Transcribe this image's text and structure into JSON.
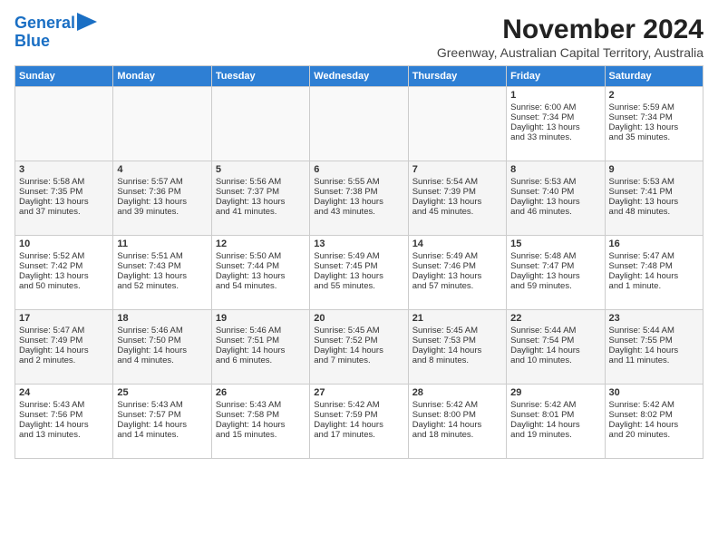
{
  "logo": {
    "line1": "General",
    "line2": "Blue"
  },
  "title": "November 2024",
  "subtitle": "Greenway, Australian Capital Territory, Australia",
  "headers": [
    "Sunday",
    "Monday",
    "Tuesday",
    "Wednesday",
    "Thursday",
    "Friday",
    "Saturday"
  ],
  "weeks": [
    [
      {
        "day": "",
        "content": ""
      },
      {
        "day": "",
        "content": ""
      },
      {
        "day": "",
        "content": ""
      },
      {
        "day": "",
        "content": ""
      },
      {
        "day": "",
        "content": ""
      },
      {
        "day": "1",
        "content": "Sunrise: 6:00 AM\nSunset: 7:34 PM\nDaylight: 13 hours\nand 33 minutes."
      },
      {
        "day": "2",
        "content": "Sunrise: 5:59 AM\nSunset: 7:34 PM\nDaylight: 13 hours\nand 35 minutes."
      }
    ],
    [
      {
        "day": "3",
        "content": "Sunrise: 5:58 AM\nSunset: 7:35 PM\nDaylight: 13 hours\nand 37 minutes."
      },
      {
        "day": "4",
        "content": "Sunrise: 5:57 AM\nSunset: 7:36 PM\nDaylight: 13 hours\nand 39 minutes."
      },
      {
        "day": "5",
        "content": "Sunrise: 5:56 AM\nSunset: 7:37 PM\nDaylight: 13 hours\nand 41 minutes."
      },
      {
        "day": "6",
        "content": "Sunrise: 5:55 AM\nSunset: 7:38 PM\nDaylight: 13 hours\nand 43 minutes."
      },
      {
        "day": "7",
        "content": "Sunrise: 5:54 AM\nSunset: 7:39 PM\nDaylight: 13 hours\nand 45 minutes."
      },
      {
        "day": "8",
        "content": "Sunrise: 5:53 AM\nSunset: 7:40 PM\nDaylight: 13 hours\nand 46 minutes."
      },
      {
        "day": "9",
        "content": "Sunrise: 5:53 AM\nSunset: 7:41 PM\nDaylight: 13 hours\nand 48 minutes."
      }
    ],
    [
      {
        "day": "10",
        "content": "Sunrise: 5:52 AM\nSunset: 7:42 PM\nDaylight: 13 hours\nand 50 minutes."
      },
      {
        "day": "11",
        "content": "Sunrise: 5:51 AM\nSunset: 7:43 PM\nDaylight: 13 hours\nand 52 minutes."
      },
      {
        "day": "12",
        "content": "Sunrise: 5:50 AM\nSunset: 7:44 PM\nDaylight: 13 hours\nand 54 minutes."
      },
      {
        "day": "13",
        "content": "Sunrise: 5:49 AM\nSunset: 7:45 PM\nDaylight: 13 hours\nand 55 minutes."
      },
      {
        "day": "14",
        "content": "Sunrise: 5:49 AM\nSunset: 7:46 PM\nDaylight: 13 hours\nand 57 minutes."
      },
      {
        "day": "15",
        "content": "Sunrise: 5:48 AM\nSunset: 7:47 PM\nDaylight: 13 hours\nand 59 minutes."
      },
      {
        "day": "16",
        "content": "Sunrise: 5:47 AM\nSunset: 7:48 PM\nDaylight: 14 hours\nand 1 minute."
      }
    ],
    [
      {
        "day": "17",
        "content": "Sunrise: 5:47 AM\nSunset: 7:49 PM\nDaylight: 14 hours\nand 2 minutes."
      },
      {
        "day": "18",
        "content": "Sunrise: 5:46 AM\nSunset: 7:50 PM\nDaylight: 14 hours\nand 4 minutes."
      },
      {
        "day": "19",
        "content": "Sunrise: 5:46 AM\nSunset: 7:51 PM\nDaylight: 14 hours\nand 6 minutes."
      },
      {
        "day": "20",
        "content": "Sunrise: 5:45 AM\nSunset: 7:52 PM\nDaylight: 14 hours\nand 7 minutes."
      },
      {
        "day": "21",
        "content": "Sunrise: 5:45 AM\nSunset: 7:53 PM\nDaylight: 14 hours\nand 8 minutes."
      },
      {
        "day": "22",
        "content": "Sunrise: 5:44 AM\nSunset: 7:54 PM\nDaylight: 14 hours\nand 10 minutes."
      },
      {
        "day": "23",
        "content": "Sunrise: 5:44 AM\nSunset: 7:55 PM\nDaylight: 14 hours\nand 11 minutes."
      }
    ],
    [
      {
        "day": "24",
        "content": "Sunrise: 5:43 AM\nSunset: 7:56 PM\nDaylight: 14 hours\nand 13 minutes."
      },
      {
        "day": "25",
        "content": "Sunrise: 5:43 AM\nSunset: 7:57 PM\nDaylight: 14 hours\nand 14 minutes."
      },
      {
        "day": "26",
        "content": "Sunrise: 5:43 AM\nSunset: 7:58 PM\nDaylight: 14 hours\nand 15 minutes."
      },
      {
        "day": "27",
        "content": "Sunrise: 5:42 AM\nSunset: 7:59 PM\nDaylight: 14 hours\nand 17 minutes."
      },
      {
        "day": "28",
        "content": "Sunrise: 5:42 AM\nSunset: 8:00 PM\nDaylight: 14 hours\nand 18 minutes."
      },
      {
        "day": "29",
        "content": "Sunrise: 5:42 AM\nSunset: 8:01 PM\nDaylight: 14 hours\nand 19 minutes."
      },
      {
        "day": "30",
        "content": "Sunrise: 5:42 AM\nSunset: 8:02 PM\nDaylight: 14 hours\nand 20 minutes."
      }
    ]
  ]
}
